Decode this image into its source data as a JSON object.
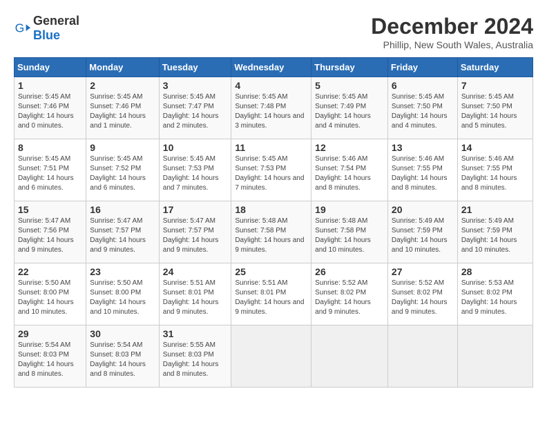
{
  "logo": {
    "text_general": "General",
    "text_blue": "Blue"
  },
  "title": "December 2024",
  "location": "Phillip, New South Wales, Australia",
  "days_of_week": [
    "Sunday",
    "Monday",
    "Tuesday",
    "Wednesday",
    "Thursday",
    "Friday",
    "Saturday"
  ],
  "weeks": [
    [
      {
        "day": "1",
        "sunrise": "5:45 AM",
        "sunset": "7:46 PM",
        "daylight": "14 hours and 0 minutes."
      },
      {
        "day": "2",
        "sunrise": "5:45 AM",
        "sunset": "7:46 PM",
        "daylight": "14 hours and 1 minute."
      },
      {
        "day": "3",
        "sunrise": "5:45 AM",
        "sunset": "7:47 PM",
        "daylight": "14 hours and 2 minutes."
      },
      {
        "day": "4",
        "sunrise": "5:45 AM",
        "sunset": "7:48 PM",
        "daylight": "14 hours and 3 minutes."
      },
      {
        "day": "5",
        "sunrise": "5:45 AM",
        "sunset": "7:49 PM",
        "daylight": "14 hours and 4 minutes."
      },
      {
        "day": "6",
        "sunrise": "5:45 AM",
        "sunset": "7:50 PM",
        "daylight": "14 hours and 4 minutes."
      },
      {
        "day": "7",
        "sunrise": "5:45 AM",
        "sunset": "7:50 PM",
        "daylight": "14 hours and 5 minutes."
      }
    ],
    [
      {
        "day": "8",
        "sunrise": "5:45 AM",
        "sunset": "7:51 PM",
        "daylight": "14 hours and 6 minutes."
      },
      {
        "day": "9",
        "sunrise": "5:45 AM",
        "sunset": "7:52 PM",
        "daylight": "14 hours and 6 minutes."
      },
      {
        "day": "10",
        "sunrise": "5:45 AM",
        "sunset": "7:53 PM",
        "daylight": "14 hours and 7 minutes."
      },
      {
        "day": "11",
        "sunrise": "5:45 AM",
        "sunset": "7:53 PM",
        "daylight": "14 hours and 7 minutes."
      },
      {
        "day": "12",
        "sunrise": "5:46 AM",
        "sunset": "7:54 PM",
        "daylight": "14 hours and 8 minutes."
      },
      {
        "day": "13",
        "sunrise": "5:46 AM",
        "sunset": "7:55 PM",
        "daylight": "14 hours and 8 minutes."
      },
      {
        "day": "14",
        "sunrise": "5:46 AM",
        "sunset": "7:55 PM",
        "daylight": "14 hours and 8 minutes."
      }
    ],
    [
      {
        "day": "15",
        "sunrise": "5:47 AM",
        "sunset": "7:56 PM",
        "daylight": "14 hours and 9 minutes."
      },
      {
        "day": "16",
        "sunrise": "5:47 AM",
        "sunset": "7:57 PM",
        "daylight": "14 hours and 9 minutes."
      },
      {
        "day": "17",
        "sunrise": "5:47 AM",
        "sunset": "7:57 PM",
        "daylight": "14 hours and 9 minutes."
      },
      {
        "day": "18",
        "sunrise": "5:48 AM",
        "sunset": "7:58 PM",
        "daylight": "14 hours and 9 minutes."
      },
      {
        "day": "19",
        "sunrise": "5:48 AM",
        "sunset": "7:58 PM",
        "daylight": "14 hours and 10 minutes."
      },
      {
        "day": "20",
        "sunrise": "5:49 AM",
        "sunset": "7:59 PM",
        "daylight": "14 hours and 10 minutes."
      },
      {
        "day": "21",
        "sunrise": "5:49 AM",
        "sunset": "7:59 PM",
        "daylight": "14 hours and 10 minutes."
      }
    ],
    [
      {
        "day": "22",
        "sunrise": "5:50 AM",
        "sunset": "8:00 PM",
        "daylight": "14 hours and 10 minutes."
      },
      {
        "day": "23",
        "sunrise": "5:50 AM",
        "sunset": "8:00 PM",
        "daylight": "14 hours and 10 minutes."
      },
      {
        "day": "24",
        "sunrise": "5:51 AM",
        "sunset": "8:01 PM",
        "daylight": "14 hours and 9 minutes."
      },
      {
        "day": "25",
        "sunrise": "5:51 AM",
        "sunset": "8:01 PM",
        "daylight": "14 hours and 9 minutes."
      },
      {
        "day": "26",
        "sunrise": "5:52 AM",
        "sunset": "8:02 PM",
        "daylight": "14 hours and 9 minutes."
      },
      {
        "day": "27",
        "sunrise": "5:52 AM",
        "sunset": "8:02 PM",
        "daylight": "14 hours and 9 minutes."
      },
      {
        "day": "28",
        "sunrise": "5:53 AM",
        "sunset": "8:02 PM",
        "daylight": "14 hours and 9 minutes."
      }
    ],
    [
      {
        "day": "29",
        "sunrise": "5:54 AM",
        "sunset": "8:03 PM",
        "daylight": "14 hours and 8 minutes."
      },
      {
        "day": "30",
        "sunrise": "5:54 AM",
        "sunset": "8:03 PM",
        "daylight": "14 hours and 8 minutes."
      },
      {
        "day": "31",
        "sunrise": "5:55 AM",
        "sunset": "8:03 PM",
        "daylight": "14 hours and 8 minutes."
      },
      null,
      null,
      null,
      null
    ]
  ]
}
